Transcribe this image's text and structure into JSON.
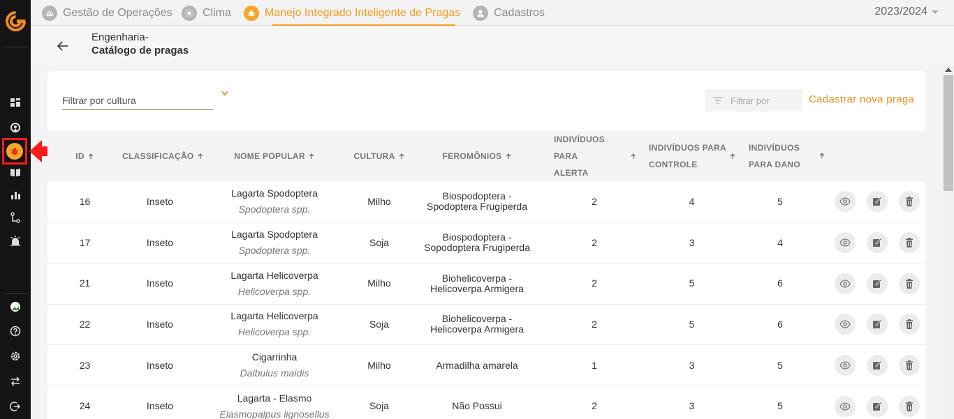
{
  "nav": {
    "tabs": [
      {
        "label": "Gestão de Operações",
        "icon": "operations-icon"
      },
      {
        "label": "Clima",
        "icon": "sun-icon"
      },
      {
        "label": "Manejo Integrado Inteligente de Pragas",
        "icon": "bug-icon"
      },
      {
        "label": "Cadastros",
        "icon": "user-icon"
      }
    ],
    "active_tab": 2,
    "season": "2023/2024"
  },
  "sidebar": {
    "icons": [
      "dashboard-icon",
      "map-pin-icon",
      "bug-icon",
      "book-icon",
      "bar-chart-icon",
      "flow-icon",
      "alarm-icon",
      "avatar-icon",
      "help-icon",
      "settings-icon",
      "swap-icon",
      "logout-icon"
    ],
    "active": "bug-icon"
  },
  "header": {
    "breadcrumb": "Engenharia-",
    "title": "Catálogo de pragas"
  },
  "filters": {
    "culture_label": "Filtrar por cultura",
    "search_placeholder": "Filtrar por",
    "new_button": "Cadastrar nova praga"
  },
  "table": {
    "columns": {
      "id": "ID",
      "classificacao": "Classificação",
      "nome_popular": "Nome popular",
      "cultura": "Cultura",
      "feromonios": "Feromônios",
      "alerta_1": "Indivíduos para",
      "alerta_2": "alerta",
      "controle_1": "Indivíduos para",
      "controle_2": "controle",
      "dano_1": "Indivíduos",
      "dano_2": "para dano"
    },
    "rows": [
      {
        "id": "16",
        "classificacao": "Inseto",
        "nome": "Lagarta Spodoptera",
        "cientifico": "Spodoptera spp.",
        "cultura": "Milho",
        "feromonio_1": "Biospodoptera -",
        "feromonio_2": "Spodoptera Frugiperda",
        "alerta": "2",
        "controle": "4",
        "dano": "5"
      },
      {
        "id": "17",
        "classificacao": "Inseto",
        "nome": "Lagarta Spodoptera",
        "cientifico": "Spodoptera spp.",
        "cultura": "Soja",
        "feromonio_1": "Biospodoptera -",
        "feromonio_2": "Sopodoptera Frugiperda",
        "alerta": "2",
        "controle": "3",
        "dano": "4"
      },
      {
        "id": "21",
        "classificacao": "Inseto",
        "nome": "Lagarta Helicoverpa",
        "cientifico": "Helicoverpa spp.",
        "cultura": "Milho",
        "feromonio_1": "Biohelicoverpa -",
        "feromonio_2": "Helicoverpa Armigera",
        "alerta": "2",
        "controle": "5",
        "dano": "6"
      },
      {
        "id": "22",
        "classificacao": "Inseto",
        "nome": "Lagarta Helicoverpa",
        "cientifico": "Helicoverpa spp.",
        "cultura": "Soja",
        "feromonio_1": "Biohelicoverpa -",
        "feromonio_2": "Helicoverpa Armigera",
        "alerta": "2",
        "controle": "5",
        "dano": "6"
      },
      {
        "id": "23",
        "classificacao": "Inseto",
        "nome": "Cigarrinha",
        "cientifico": "Dalbulus maidis",
        "cultura": "Milho",
        "feromonio_1": "Armadilha amarela",
        "feromonio_2": "",
        "alerta": "1",
        "controle": "3",
        "dano": "5"
      },
      {
        "id": "24",
        "classificacao": "Inseto",
        "nome": "Lagarta - Elasmo",
        "cientifico": "Elasmopalpus lignosellus",
        "cultura": "Soja",
        "feromonio_1": "Não Possui",
        "feromonio_2": "",
        "alerta": "2",
        "controle": "3",
        "dano": "5"
      }
    ]
  },
  "colors": {
    "accent": "#f49b1f",
    "sidebar": "#141414",
    "highlight": "#ff1a1a"
  }
}
